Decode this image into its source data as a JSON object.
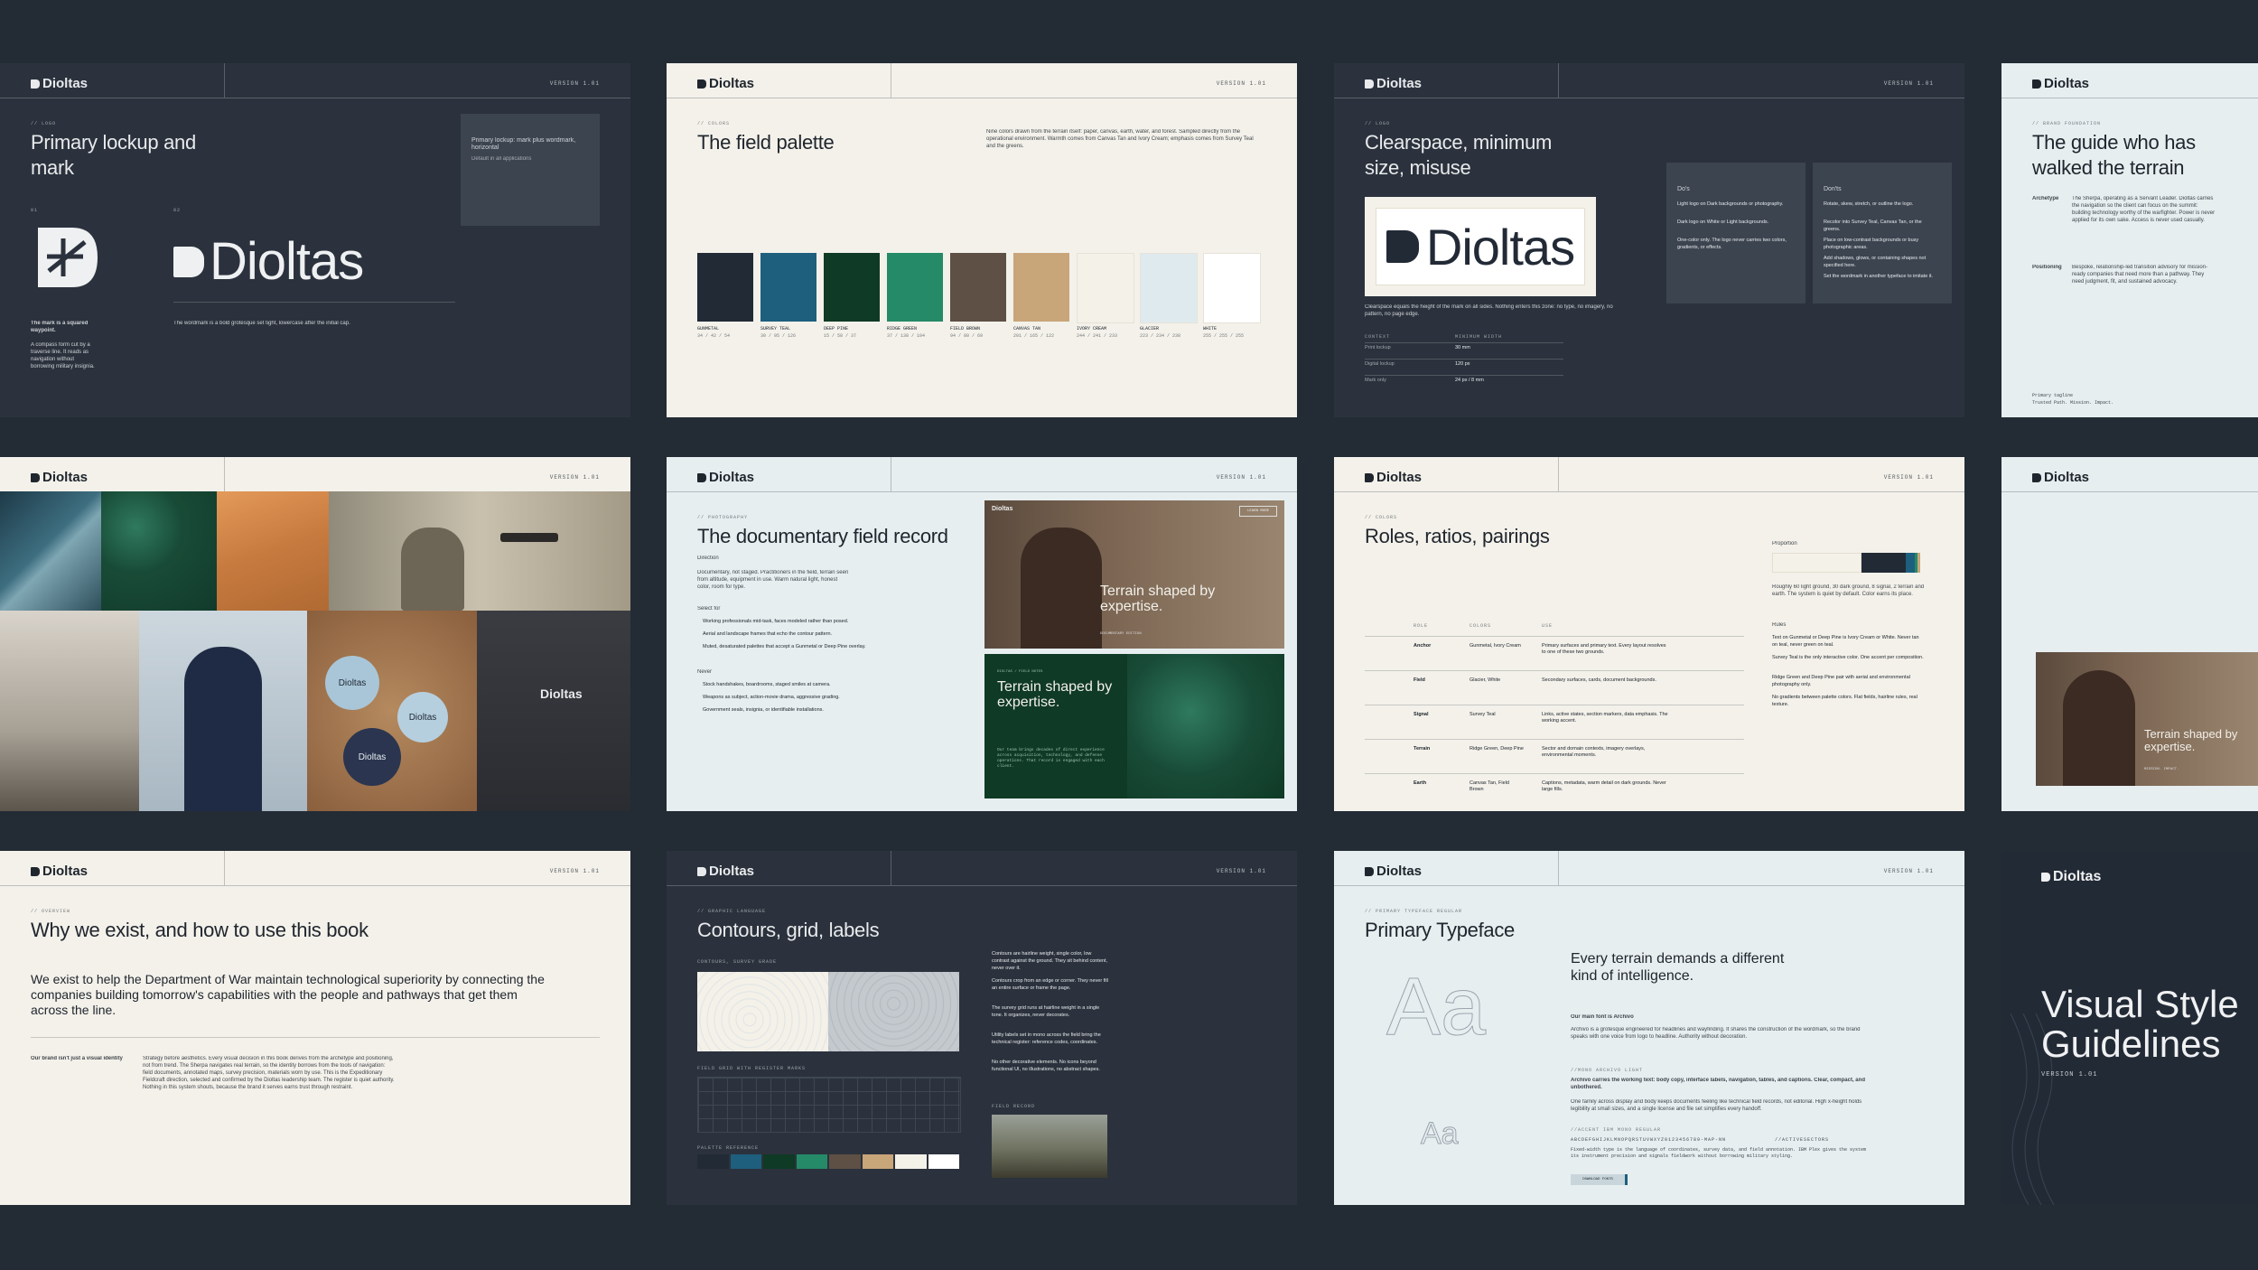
{
  "brand": "Dioltas",
  "version": "VERSION 1.01",
  "colors": {
    "background": "#232b35",
    "gunmetal": "#222a36",
    "survey_teal": "#1e5f7e",
    "deep_pine": "#0f3a25",
    "ridge_green": "#258a68",
    "field_brown": "#5e5045",
    "canvas_tan": "#c9a57a",
    "ivory_cream": "#f4f1e9",
    "glacier": "#dfeaee",
    "white": "#ffffff"
  },
  "slide1": {
    "eyebrow": "// LOGO",
    "title": "Primary lockup and mark",
    "note_title": "Primary lockup: mark plus wordmark, horizontal",
    "note_body": "Default in all applications",
    "mark_caption_title": "The mark is a squared waypoint.",
    "mark_caption": "A compass form cut by a traverse line. It reads as navigation without borrowing military insignia.",
    "wordmark_caption": "The wordmark is a bold grotesque set tight, lowercase after the initial cap.",
    "index_a": "01",
    "index_b": "02"
  },
  "slide2": {
    "eyebrow": "// COLORS",
    "title": "The field palette",
    "intro": "Nine colors drawn from the terrain itself: paper, canvas, earth, water, and forest. Sampled directly from the operational environment. Warmth comes from Canvas Tan and Ivory Cream; emphasis comes from Survey Teal and the greens.",
    "swatches": [
      {
        "name": "GUNMETAL",
        "key": "gunmetal",
        "values": "34 / 42 / 54"
      },
      {
        "name": "SURVEY TEAL",
        "key": "survey_teal",
        "values": "30 / 95 / 126"
      },
      {
        "name": "DEEP PINE",
        "key": "deep_pine",
        "values": "15 / 58 / 37"
      },
      {
        "name": "RIDGE GREEN",
        "key": "ridge_green",
        "values": "37 / 138 / 104"
      },
      {
        "name": "FIELD BROWN",
        "key": "field_brown",
        "values": "94 / 80 / 69"
      },
      {
        "name": "CANVAS TAN",
        "key": "canvas_tan",
        "values": "201 / 165 / 122"
      },
      {
        "name": "IVORY CREAM",
        "key": "ivory_cream",
        "values": "244 / 241 / 233"
      },
      {
        "name": "GLACIER",
        "key": "glacier",
        "values": "223 / 234 / 238"
      },
      {
        "name": "WHITE",
        "key": "white",
        "values": "255 / 255 / 255"
      }
    ]
  },
  "slide3": {
    "eyebrow": "// LOGO",
    "title": "Clearspace, minimum size, misuse",
    "clearspace_note": "Clearspace equals the height of the mark on all sides. Nothing enters this zone: no type, no imagery, no pattern, no page edge.",
    "table_head": [
      "CONTEXT",
      "MINIMUM WIDTH"
    ],
    "table_rows": [
      [
        "Print lockup",
        "30 mm"
      ],
      [
        "Digital lockup",
        "120 px"
      ],
      [
        "Mark only",
        "24 px / 8 mm"
      ]
    ],
    "dos_title": "Do's",
    "dos": [
      "Light logo on Dark backgrounds or photography.",
      "Dark logo on White or Light backgrounds.",
      "One-color only. The logo never carries two colors, gradients, or effects."
    ],
    "donts_title": "Don'ts",
    "donts": [
      "Rotate, skew, stretch, or outline the logo.",
      "Recolor into Survey Teal, Canvas Tan, or the greens.",
      "Place on low-contrast backgrounds or busy photographic areas.",
      "Add shadows, glows, or containing shapes not specified here.",
      "Set the wordmark in another typeface to imitate it."
    ]
  },
  "slide4": {
    "eyebrow": "// BRAND FOUNDATION",
    "title": "The guide who has walked the terrain",
    "archetype_label": "Archetype",
    "archetype": "The Sherpa, operating as a Servant Leader. Dioltas carries the navigation so the client can focus on the summit: building technology worthy of the warfighter. Power is never applied for its own sake. Access is never used casually.",
    "positioning_label": "Positioning",
    "positioning": "Bespoke, relationship-led transition advisory for mission-ready companies that need more than a pathway. They need judgment, fit, and sustained advocacy.",
    "footer_title": "Primary tagline",
    "footer_body": "Trusted Path. Mission. Impact."
  },
  "slide6": {
    "eyebrow": "// PHOTOGRAPHY",
    "title": "The documentary field record",
    "direction_label": "Direction",
    "direction": "Documentary, not staged. Practitioners in the field, terrain seen from altitude, equipment in use. Warm natural light, honest color, room for type.",
    "select_label": "Select for",
    "select": [
      "Working professionals mid-task, faces modeled rather than posed.",
      "Aerial and landscape frames that echo the contour pattern.",
      "Muted, desaturated palettes that accept a Gunmetal or Deep Pine overlay."
    ],
    "never_label": "Never",
    "never": [
      "Stock handshakes, boardrooms, staged smiles at camera.",
      "Weapons as subject, action-movie drama, aggressive grading.",
      "Government seals, insignia, or identifiable installations."
    ],
    "card_headline": "Terrain shaped by expertise.",
    "card_button": "LEARN MORE",
    "card_caption": "DOCUMENTARY EDITION",
    "green_eyebrow": "DIOLTAS / FIELD NOTES",
    "green_body": "Our team brings decades of direct experience across acquisition, technology, and defense operations. That record is engaged with each client."
  },
  "slide7": {
    "eyebrow": "// COLORS",
    "title": "Roles, ratios, pairings",
    "proportion_label": "Proportion",
    "proportion_note": "Roughly 60 light ground, 30 dark ground, 8 signal, 2 terrain and earth. The system is quiet by default. Color earns its place.",
    "table_head": [
      "ROLE",
      "COLORS",
      "USE"
    ],
    "rows": [
      [
        "Anchor",
        "Gunmetal, Ivory Cream",
        "Primary surfaces and primary text. Every layout resolves to one of these two grounds."
      ],
      [
        "Field",
        "Glacier, White",
        "Secondary surfaces, cards, document backgrounds."
      ],
      [
        "Signal",
        "Survey Teal",
        "Links, active states, section markers, data emphasis. The working accent."
      ],
      [
        "Terrain",
        "Ridge Green, Deep Pine",
        "Sector and domain contexts, imagery overlays, environmental moments."
      ],
      [
        "Earth",
        "Canvas Tan, Field Brown",
        "Captions, metadata, warm detail on dark grounds. Never large fills."
      ]
    ],
    "rules_label": "Rules",
    "rules": [
      "Text on Gunmetal or Deep Pine is Ivory Cream or White. Never tan on teal, never green on teal.",
      "Survey Teal is the only interactive color. One accent per composition.",
      "Ridge Green and Deep Pine pair with aerial and environmental photography only.",
      "No gradients between palette colors. Flat fields, hairline rules, real texture."
    ]
  },
  "slide8": {
    "card_headline": "Terrain shaped by expertise.",
    "card_caption": "MISSION. IMPACT."
  },
  "slide9": {
    "eyebrow": "// OVERVIEW",
    "title": "Why we exist, and how to use this book",
    "lead": "We exist to help the Department of War maintain technological superiority by connecting the companies building tomorrow's capabilities with the people and pathways that get them across the line.",
    "aside_label": "Our brand isn't just a visual identity",
    "aside": "Strategy before aesthetics. Every visual decision in this book derives from the archetype and positioning, not from trend. The Sherpa navigates real terrain, so the identity borrows from the tools of navigation: field documents, annotated maps, survey precision, materials worn by use. This is the Expeditionary Fieldcraft direction, selected and confirmed by the Dioltas leadership team. The register is quiet authority. Nothing in this system shouts, because the brand it serves earns trust through restraint."
  },
  "slide10": {
    "eyebrow": "// GRAPHIC LANGUAGE",
    "title": "Contours, grid, labels",
    "contour_caption": "CONTOURS, SURVEY GRADE",
    "grid_caption": "FIELD GRID WITH REGISTER MARKS",
    "strip_caption": "PALETTE REFERENCE",
    "notes": [
      "Contours are hairline weight, single color, low contrast against the ground. They sit behind content, never over it.",
      "Contours crop from an edge or corner. They never fill an entire surface or frame the page.",
      "The survey grid runs at hairline weight in a single tone. It organizes, never decorates.",
      "Utility labels set in mono across the field bring the technical register: reference codes, coordinates.",
      "No other decorative elements. No icons beyond functional UI, no illustrations, no abstract shapes."
    ],
    "photo_caption": "FIELD RECORD"
  },
  "slide11": {
    "eyebrow": "// PRIMARY TYPEFACE REGULAR",
    "title": "Primary Typeface",
    "glyph": "Aa",
    "headline": "Every terrain demands a different kind of intelligence.",
    "main_font_label": "Our main font is Archivo",
    "main_font": "Archivo is a grotesque engineered for headlines and wayfinding. It shares the construction of the wordmark, so the brand speaks with one voice from logo to headline. Authority without decoration.",
    "mono_eyebrow": "//MONO ARCHIVO LIGHT",
    "working_label": "Archivo carries the working text: body copy, interface labels, navigation, tables, and captions. Clear, compact, and unbothered.",
    "family_note": "One family across display and body keeps documents feeling like technical field records, not editorial. High x-height holds legibility at small sizes, and a single license and file set simplifies every handoff.",
    "mono_eyebrow2": "//ACCENT IBM MONO REGULAR",
    "alphabet": "ABCDEFGHIJKLMNOPQRSTUVWXYZ0123456789-MAP-NN",
    "alphabet2": "//ACTIVESECTORS",
    "mono_note": "Fixed-width type is the language of coordinates, survey data, and field annotation. IBM Plex gives the system its instrument precision and signals fieldwork without borrowing military styling.",
    "button_label": "DOWNLOAD FONTS"
  },
  "slide12": {
    "title": "Visual Style Guidelines",
    "version": "VERSION 1.01"
  }
}
